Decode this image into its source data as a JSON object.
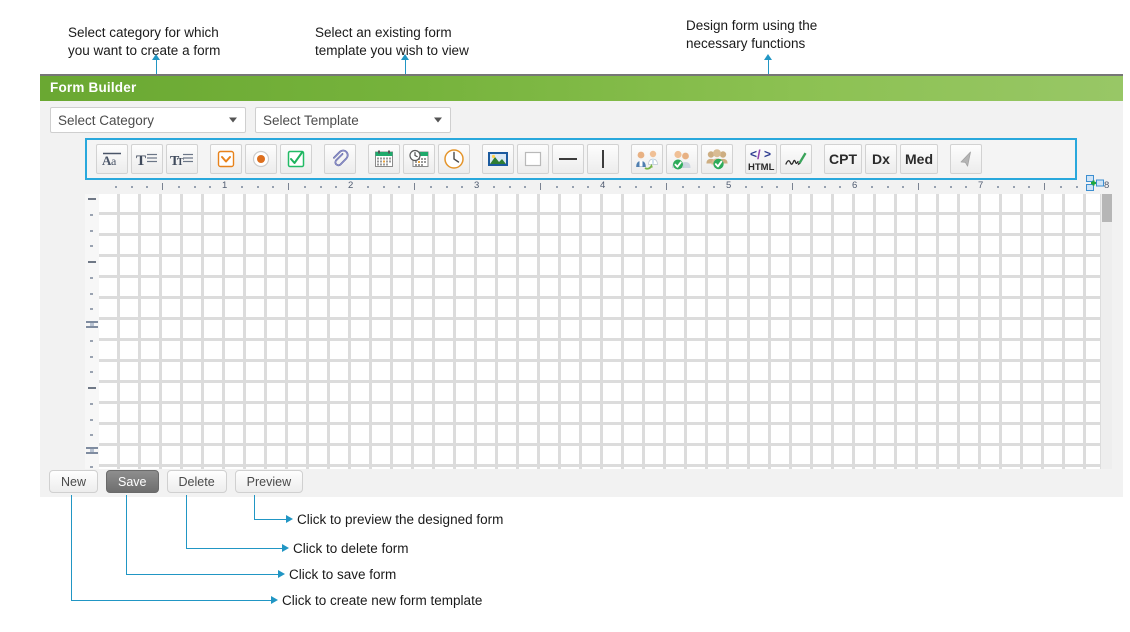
{
  "window": {
    "title": "Form Builder"
  },
  "selects": [
    {
      "name": "category",
      "value": "Select Category"
    },
    {
      "name": "template",
      "value": "Select Template"
    }
  ],
  "toolbar": {
    "groups": [
      {
        "name": "text-group",
        "buttons": [
          {
            "icon": "label-text-icon",
            "label": ""
          },
          {
            "icon": "textbox-icon",
            "label": ""
          },
          {
            "icon": "multiline-text-icon",
            "label": ""
          }
        ]
      },
      {
        "name": "choice-group",
        "buttons": [
          {
            "icon": "dropdown-icon",
            "label": ""
          },
          {
            "icon": "radio-icon",
            "label": ""
          },
          {
            "icon": "checkbox-icon",
            "label": ""
          }
        ]
      },
      {
        "name": "attachment-group",
        "buttons": [
          {
            "icon": "attachment-icon",
            "label": ""
          }
        ]
      },
      {
        "name": "datetime-group",
        "buttons": [
          {
            "icon": "date-icon",
            "label": ""
          },
          {
            "icon": "datetime-icon",
            "label": ""
          },
          {
            "icon": "time-icon",
            "label": ""
          }
        ]
      },
      {
        "name": "media-shape-group",
        "buttons": [
          {
            "icon": "image-icon",
            "label": ""
          },
          {
            "icon": "rectangle-icon",
            "label": ""
          },
          {
            "icon": "horizontal-line-icon",
            "label": ""
          },
          {
            "icon": "vertical-line-icon",
            "label": ""
          }
        ]
      },
      {
        "name": "people-group",
        "buttons": [
          {
            "icon": "provider-referral-icon",
            "label": ""
          },
          {
            "icon": "provider-verified-icon",
            "label": ""
          },
          {
            "icon": "group-verified-icon",
            "label": ""
          }
        ]
      },
      {
        "name": "code-group",
        "buttons": [
          {
            "icon": "html-icon",
            "label": "HTML"
          },
          {
            "icon": "signature-icon",
            "label": ""
          }
        ]
      },
      {
        "name": "coding-group",
        "buttons": [
          {
            "icon": "cpt-icon",
            "label": "CPT"
          },
          {
            "icon": "dx-icon",
            "label": "Dx"
          },
          {
            "icon": "med-icon",
            "label": "Med"
          }
        ]
      },
      {
        "name": "select-group",
        "buttons": [
          {
            "icon": "cursor-arrow-icon",
            "label": ""
          }
        ]
      }
    ]
  },
  "ruler": {
    "horizontal_numbers": [
      "1",
      "2",
      "3",
      "4",
      "5",
      "6",
      "7",
      "8"
    ]
  },
  "canvas": {
    "anchor_icon": "move-anchor-icon"
  },
  "buttons": [
    {
      "name": "new",
      "label": "New",
      "primary": false
    },
    {
      "name": "save",
      "label": "Save",
      "primary": true
    },
    {
      "name": "delete",
      "label": "Delete",
      "primary": false
    },
    {
      "name": "preview",
      "label": "Preview",
      "primary": false
    }
  ],
  "annotations": {
    "category": "Select category for which\nyou want to create a form",
    "template": "Select an existing form\ntemplate you wish to view",
    "design": "Design form using the\nnecessary functions",
    "preview": "Click to preview the designed form",
    "delete": "Click to delete form",
    "save": "Click to save form",
    "new": "Click to create new form template"
  },
  "colors": {
    "accent_green": "#7ab648",
    "callout_blue": "#2196c4",
    "toolbar_outline": "#29a8dc"
  }
}
